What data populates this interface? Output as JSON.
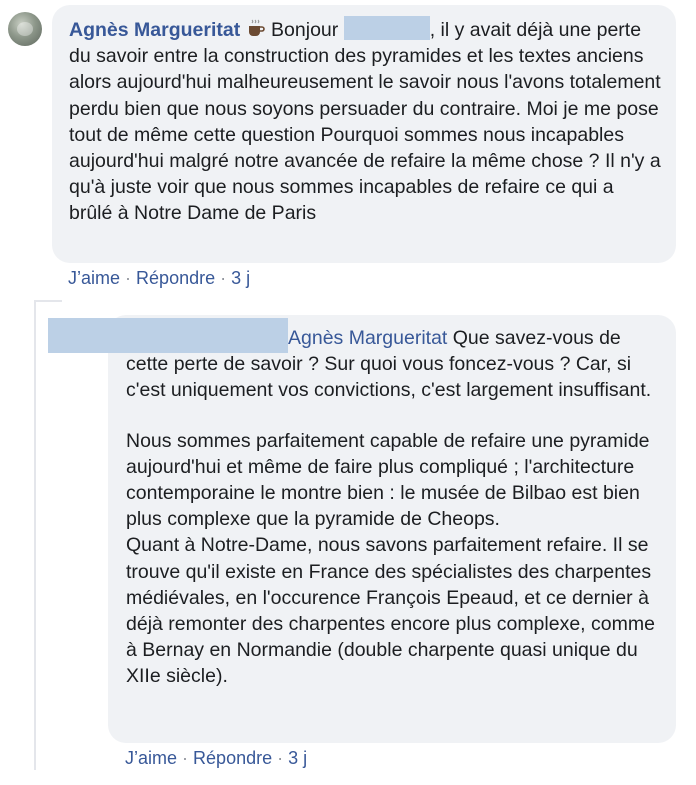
{
  "comment1": {
    "author": "Agnès Margueritat",
    "emoji_icon": "coffee-icon",
    "greeting": "Bonjour",
    "text_after_redaction": ", il y avait déjà une perte du savoir entre la construction des pyramides et les textes anciens alors aujourd'hui malheureusement le savoir nous l'avons totalement perdu bien que nous soyons persuader du contraire. Moi je me pose tout de même cette question Pourquoi sommes nous incapables aujourd'hui malgré notre avancée de refaire la même chose ? Il n'y a qu'à juste voir que nous sommes incapables de refaire ce qui a brûlé à Notre Dame de Paris",
    "actions": {
      "like": "J’aime",
      "reply": "Répondre",
      "time": "3 j",
      "separator": "·"
    }
  },
  "comment2": {
    "mention": "Agnès Margueritat",
    "paragraph1": " Que savez-vous de cette perte de savoir ? Sur quoi vous foncez-vous ? Car, si c'est uniquement vos convictions, c'est largement insuffisant.",
    "paragraph2": "Nous sommes parfaitement capable de refaire une pyramide aujourd'hui et même de faire plus compliqué ; l'architecture contemporaine le montre bien : le musée de Bilbao est bien plus complexe que la pyramide de Cheops.",
    "paragraph3": "Quant à Notre-Dame, nous savons parfaitement refaire. Il se trouve qu'il existe en France des spécialistes des charpentes médiévales, en l'occurence François Epeaud, et ce dernier à déjà remonter des charpentes encore plus complexe, comme à Bernay en Normandie (double charpente quasi unique du XIIe siècle).",
    "actions": {
      "like": "J’aime",
      "reply": "Répondre",
      "time": "3 j",
      "separator": "·"
    }
  },
  "colors": {
    "bubble_bg": "#f0f2f5",
    "name_link": "#385898",
    "redaction": "#bcd0e6",
    "meta_text": "#65676b"
  }
}
